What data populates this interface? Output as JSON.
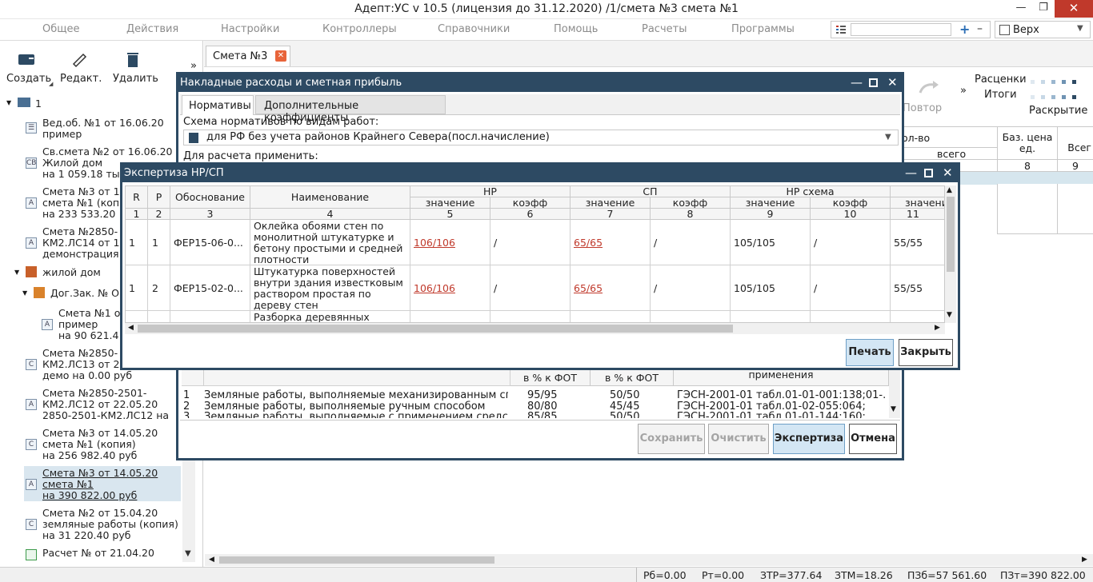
{
  "window": {
    "title": "Адепт:УС v 10.5 (лицензия до 31.12.2020) /1/смета №3 смета №1",
    "close": "✕",
    "maximize": "❐",
    "minimize": "—"
  },
  "menu": [
    "Общее",
    "Действия",
    "Настройки",
    "Контроллеры",
    "Справочники",
    "Помощь",
    "Расчеты",
    "Программы"
  ],
  "search": {
    "value": "",
    "plus": "+",
    "minus": "–"
  },
  "position_select": "Верх",
  "toolbar": {
    "create": "Создать",
    "edit": "Редакт.",
    "delete": "Удалить",
    "more": "»"
  },
  "tree": [
    {
      "l1": "1"
    },
    {
      "l1": "Вед.об. №1 от 16.06.20",
      "l2": "пример"
    },
    {
      "l1": "Св.смета №2 от 16.06.20",
      "l2": "Жилой дом",
      "l3": "на 1 059.18 ты"
    },
    {
      "l1": "Смета №3 от 1",
      "l2": "смета №1 (копи",
      "l3": "на 233 533.20"
    },
    {
      "l1": "Смета №2850-",
      "l2": "КМ2.ЛС14 от 1",
      "l3": "демонстрация"
    },
    {
      "l1": "жилой дом"
    },
    {
      "l1": "Дог.Зак. № О"
    },
    {
      "l1": "Смета №1 о",
      "l2": "пример",
      "l3": "на 90 621.4"
    },
    {
      "l1": "Смета №2850-",
      "l2": "КМ2.ЛС13 от 2",
      "l3": "демо    на 0.00 руб"
    },
    {
      "l1": "Смета №2850-2501-",
      "l2": "КМ2.ЛС12 от 22.05.20",
      "l3": "2850-2501-КМ2.ЛС12     на"
    },
    {
      "l1": "Смета №3 от 14.05.20",
      "l2": "смета №1 (копия)",
      "l3": "на 256 982.40 руб"
    },
    {
      "l1": "Смета №3 от 14.05.20",
      "l2": "смета №1",
      "l3": "на 390 822.00 руб"
    },
    {
      "l1": "Смета №2 от 15.04.20",
      "l2": "земляные работы (копия)",
      "l3": "на 31 220.40 руб"
    },
    {
      "l1": "Расчет № от 21.04.20"
    }
  ],
  "tab": {
    "label": "Смета №3",
    "close": "✕"
  },
  "right_toolbar": {
    "redo": "Повтор",
    "prices": "Расценки",
    "totals": "Итоги",
    "expand": "Раскрытие",
    "more": "»"
  },
  "bg_table": {
    "qty": "ол-во",
    "total": "всего",
    "base_price": "Баз. цена ед.",
    "all": "Всег",
    "c8": "8",
    "c9": "9"
  },
  "dlg1": {
    "title": "Накладные расходы и сметная прибыль",
    "tabs": [
      "Нормативы",
      "Дополнительные коэффициенты"
    ],
    "scheme_label": "Схема нормативов по видам работ:",
    "scheme_value": "для РФ без учета районов Крайнего Севера(посл.начисление)",
    "apply_label": "Для расчета применить:",
    "cols": {
      "pct1": "в % к ФОТ",
      "pct2": "в % к ФОТ",
      "apply": "применения"
    },
    "rows": [
      {
        "n": "1",
        "name": "Земляные работы, выполняемые механизированным спо...",
        "nr": "95/95",
        "sp": "50/50",
        "ref": "ГЭСН-2001-01 табл.01-01-001:138;01-..."
      },
      {
        "n": "2",
        "name": "Земляные работы, выполняемые ручным способом",
        "nr": "80/80",
        "sp": "45/45",
        "ref": "ГЭСН-2001-01 табл.01-02-055:064;"
      },
      {
        "n": "3",
        "name": "Земляные работы, выполняемые с применением средств...",
        "nr": "85/85",
        "sp": "50/50",
        "ref": "ГЭСН-2001-01 табл.01-01-144:160;"
      }
    ],
    "buttons": {
      "save": "Сохранить",
      "clear": "Очистить",
      "expertise": "Экспертиза",
      "cancel": "Отмена"
    }
  },
  "dlg2": {
    "title": "Экспертиза НР/СП",
    "headers": {
      "r": "R",
      "p": "P",
      "basis": "Обоснование",
      "name": "Наименование",
      "nr": "НР",
      "sp": "СП",
      "nrscheme": "НР схема",
      "value": "значение",
      "coef": "коэфф"
    },
    "nums": [
      "1",
      "2",
      "3",
      "4",
      "5",
      "6",
      "7",
      "8",
      "9",
      "10",
      "11"
    ],
    "rows": [
      {
        "r": "1",
        "p": "1",
        "basis": "ФЕР15-06-0...",
        "name": "Оклейка обоями стен по монолитной штукатурке и бетону простыми и средней плотности",
        "nr": "106/106",
        "nrk": "/",
        "sp": "65/65",
        "spk": "/",
        "sch": "105/105",
        "schk": "/",
        "c11": "55/55"
      },
      {
        "r": "1",
        "p": "2",
        "basis": "ФЕР15-02-0...",
        "name": "Штукатурка поверхностей внутри здания известковым раствором простая по дереву стен",
        "nr": "106/106",
        "nrk": "/",
        "sp": "65/65",
        "spk": "/",
        "sch": "105/105",
        "schk": "/",
        "c11": "55/55"
      },
      {
        "r": "",
        "p": "",
        "basis": "",
        "name": "Разборка деревянных",
        "nr": "",
        "nrk": "",
        "sp": "",
        "spk": "",
        "sch": "",
        "schk": "",
        "c11": ""
      }
    ],
    "buttons": {
      "print": "Печать",
      "close": "Закрыть"
    }
  },
  "status": [
    "Рб=0.00",
    "Рт=0.00",
    "ЗТР=377.64",
    "ЗТМ=18.26",
    "ПЗб=57 561.60",
    "ПЗт=390 822.00"
  ]
}
